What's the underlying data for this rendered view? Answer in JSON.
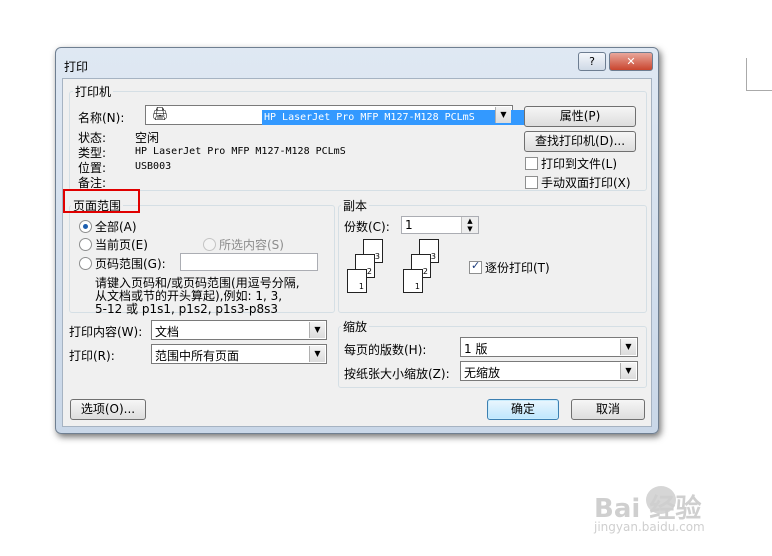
{
  "dialog": {
    "title": "打印",
    "help_label": "?",
    "close_label": "✕"
  },
  "printer": {
    "group_label": "打印机",
    "name_label": "名称(N):",
    "name_value": "HP LaserJet Pro MFP M127-M128 PCLmS",
    "status_label": "状态:",
    "status_value": "空闲",
    "type_label": "类型:",
    "type_value": "HP LaserJet Pro MFP M127-M128 PCLmS",
    "where_label": "位置:",
    "where_value": "USB003",
    "comment_label": "备注:",
    "properties_button": "属性(P)",
    "find_button": "查找打印机(D)...",
    "print_to_file_label": "打印到文件(L)",
    "print_to_file_checked": false,
    "manual_duplex_label": "手动双面打印(X)",
    "manual_duplex_checked": false
  },
  "page_range": {
    "group_label": "页面范围",
    "all_label": "全部(A)",
    "current_label": "当前页(E)",
    "selection_label": "所选内容(S)",
    "pages_label": "页码范围(G):",
    "pages_value": "",
    "selected": "all",
    "hint_line1": "请键入页码和/或页码范围(用逗号分隔,",
    "hint_line2": "从文档或节的开头算起),例如: 1, 3,",
    "hint_line3": "5-12 或 p1s1, p1s2, p1s3-p8s3"
  },
  "copies": {
    "group_label": "副本",
    "copies_label": "份数(C):",
    "copies_value": "1",
    "collate_label": "逐份打印(T)",
    "collate_checked": true,
    "page_numbers": [
      "1",
      "2",
      "3"
    ]
  },
  "print_what": {
    "label": "打印内容(W):",
    "value": "文档"
  },
  "print": {
    "label": "打印(R):",
    "value": "范围中所有页面"
  },
  "zoom": {
    "group_label": "缩放",
    "pages_per_sheet_label": "每页的版数(H):",
    "pages_per_sheet_value": "1 版",
    "scale_label": "按纸张大小缩放(Z):",
    "scale_value": "无缩放"
  },
  "buttons": {
    "options": "选项(O)...",
    "ok": "确定",
    "cancel": "取消"
  },
  "watermark": {
    "logo": "Bai  经验",
    "url": "jingyan.baidu.com"
  }
}
